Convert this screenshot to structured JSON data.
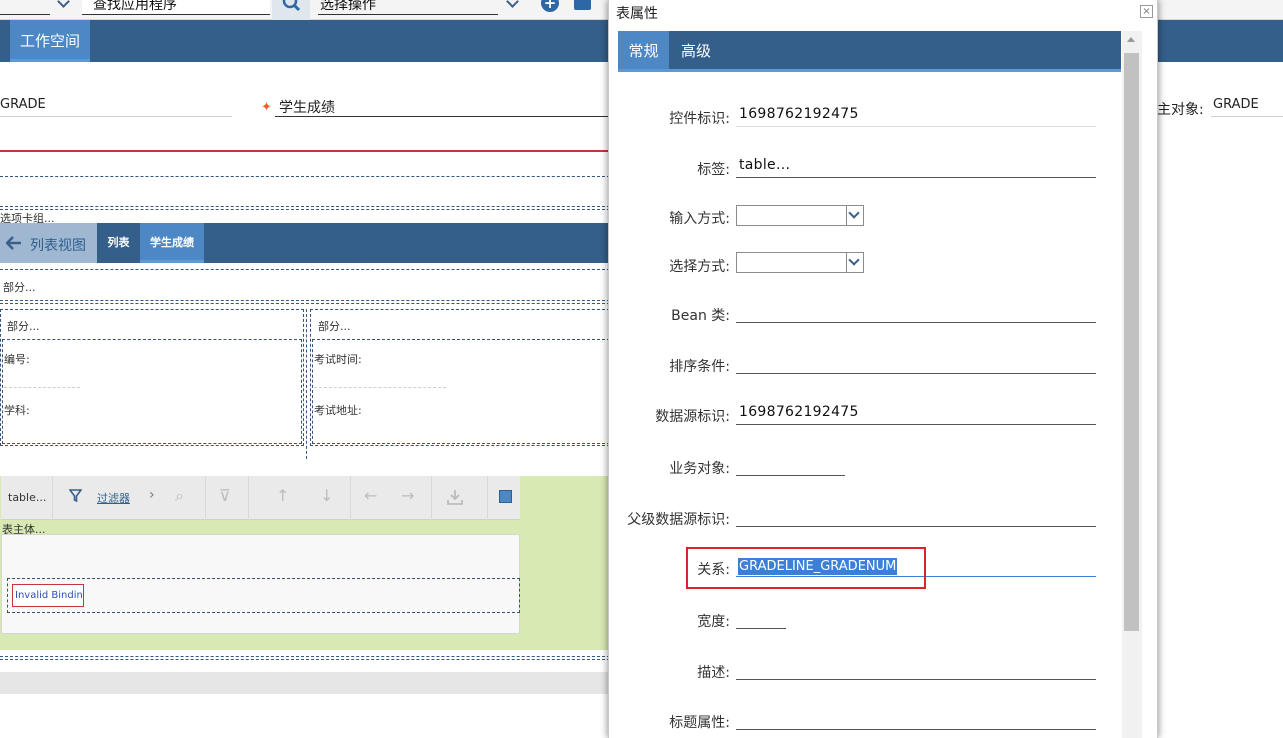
{
  "toolbar": {
    "find_app": "查找应用程序",
    "select_action": "选择操作"
  },
  "workspace": {
    "tab": "工作空间"
  },
  "form": {
    "left_value": "GRADE",
    "required_mark": "✦",
    "desc_value": "学生成绩",
    "main_object_label": "主对象:",
    "main_object_value": "GRADE"
  },
  "canvas": {
    "tab_group": "选项卡组...",
    "list_view": "列表视图",
    "tab_list": "列表",
    "tab_grade": "学生成绩",
    "section1": "部分...",
    "section2": "部分...",
    "section3": "部分...",
    "field_number": "编号:",
    "field_subject": "学科:",
    "field_exam_time": "考试时间:",
    "field_exam_place": "考试地址:",
    "table_label": "table...",
    "filter_label": "过滤器",
    "table_body": "表主体...",
    "invalid_binding": "Invalid Bindin"
  },
  "dialog": {
    "title": "表属性",
    "close": "×",
    "tabs": [
      {
        "label": "常规"
      },
      {
        "label": "高级"
      }
    ],
    "fields": {
      "control_id": {
        "label": "控件标识:",
        "value": "1698762192475"
      },
      "tag": {
        "label": "标签:",
        "value": "table..."
      },
      "input_mode": {
        "label": "输入方式:"
      },
      "select_mode": {
        "label": "选择方式:"
      },
      "bean_class": {
        "label": "Bean 类:"
      },
      "order_by": {
        "label": "排序条件:"
      },
      "datasrc_id": {
        "label": "数据源标识:",
        "value": "1698762192475"
      },
      "mbo_name": {
        "label": "业务对象:"
      },
      "parent_ds": {
        "label": "父级数据源标识:"
      },
      "relationship": {
        "label": "关系:",
        "value": "GRADELINE_GRADENUM"
      },
      "width": {
        "label": "宽度:"
      },
      "description": {
        "label": "描述:"
      },
      "title_attr": {
        "label": "标题属性:"
      }
    }
  }
}
